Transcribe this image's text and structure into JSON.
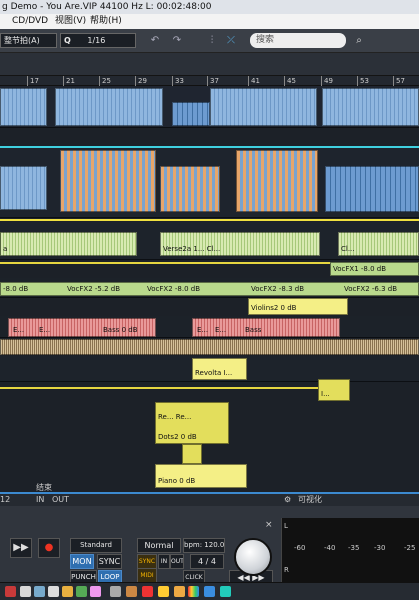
{
  "window": {
    "title": "g Demo - You Are.VIP   44100 Hz L: 00:02:48:00"
  },
  "menu": {
    "items": [
      "CD/DVD",
      "视图(V)",
      "帮助(H)"
    ]
  },
  "toolbar": {
    "snap_value": "整节拍(A)",
    "grid_value": "1/16",
    "search_placeholder": "搜索"
  },
  "ruler": {
    "bars": [
      "17",
      "21",
      "25",
      "29",
      "33",
      "37",
      "41",
      "45",
      "49",
      "53",
      "57"
    ]
  },
  "clips": {
    "verse2a": "Verse2a",
    "verse2a_num": "1...",
    "ci1": "Cl...",
    "ci2": "Cl...",
    "a_short": "a",
    "vocfx1_label": "VocFX1",
    "vocfx1_db": "-8.0 dB",
    "fx_db1": "-8.0 dB",
    "vocfx2_a": "VocFX2",
    "vocfx2_a_db": "-5.2 dB",
    "vocfx2_b": "VocFX2",
    "vocfx2_b_db": "-8.0 dB",
    "vocfx2_c": "VocFX2",
    "vocfx2_c_db": "-8.3 dB",
    "vocfx2_d": "VocFX2",
    "vocfx2_d_db": "-6.3 dB",
    "violins2": "Violins2",
    "violins2_db": "0 dB",
    "bass_e1": "E...",
    "bass_e2": "E...",
    "bass": "Bass",
    "bass_db": "0 dB",
    "bass_e3": "E...",
    "bass_e4": "E...",
    "bass2": "Bass",
    "revolta": "Revolta I...",
    "dots_re1": "Re...",
    "dots_re2": "Re...",
    "dots2": "Dots2",
    "dots2_db": "0 dB",
    "i_clip": "I...",
    "piano": "Piano",
    "piano_db": "0 dB"
  },
  "transport": {
    "left_tab": "12",
    "in_label": "IN",
    "out_label": "OUT",
    "end_label": "结束",
    "mode_select": "Standard",
    "mon": "MON",
    "sync": "SYNC",
    "punch": "PUNCH",
    "loop": "LOOP",
    "normal": "Normal",
    "bpm": "bpm: 120.0",
    "sync_small": "SYNC",
    "midi_small": "MIDI",
    "in_small": "IN",
    "out_small": "OUT",
    "time_sig_num": "4",
    "time_sig_den": "4",
    "click": "CLICK",
    "meter_title": "可视化",
    "meter_labels": [
      "-60",
      "-40",
      "-35",
      "-30",
      "-25"
    ],
    "meter_L": "L",
    "meter_R": "R",
    "close_x": "×"
  }
}
